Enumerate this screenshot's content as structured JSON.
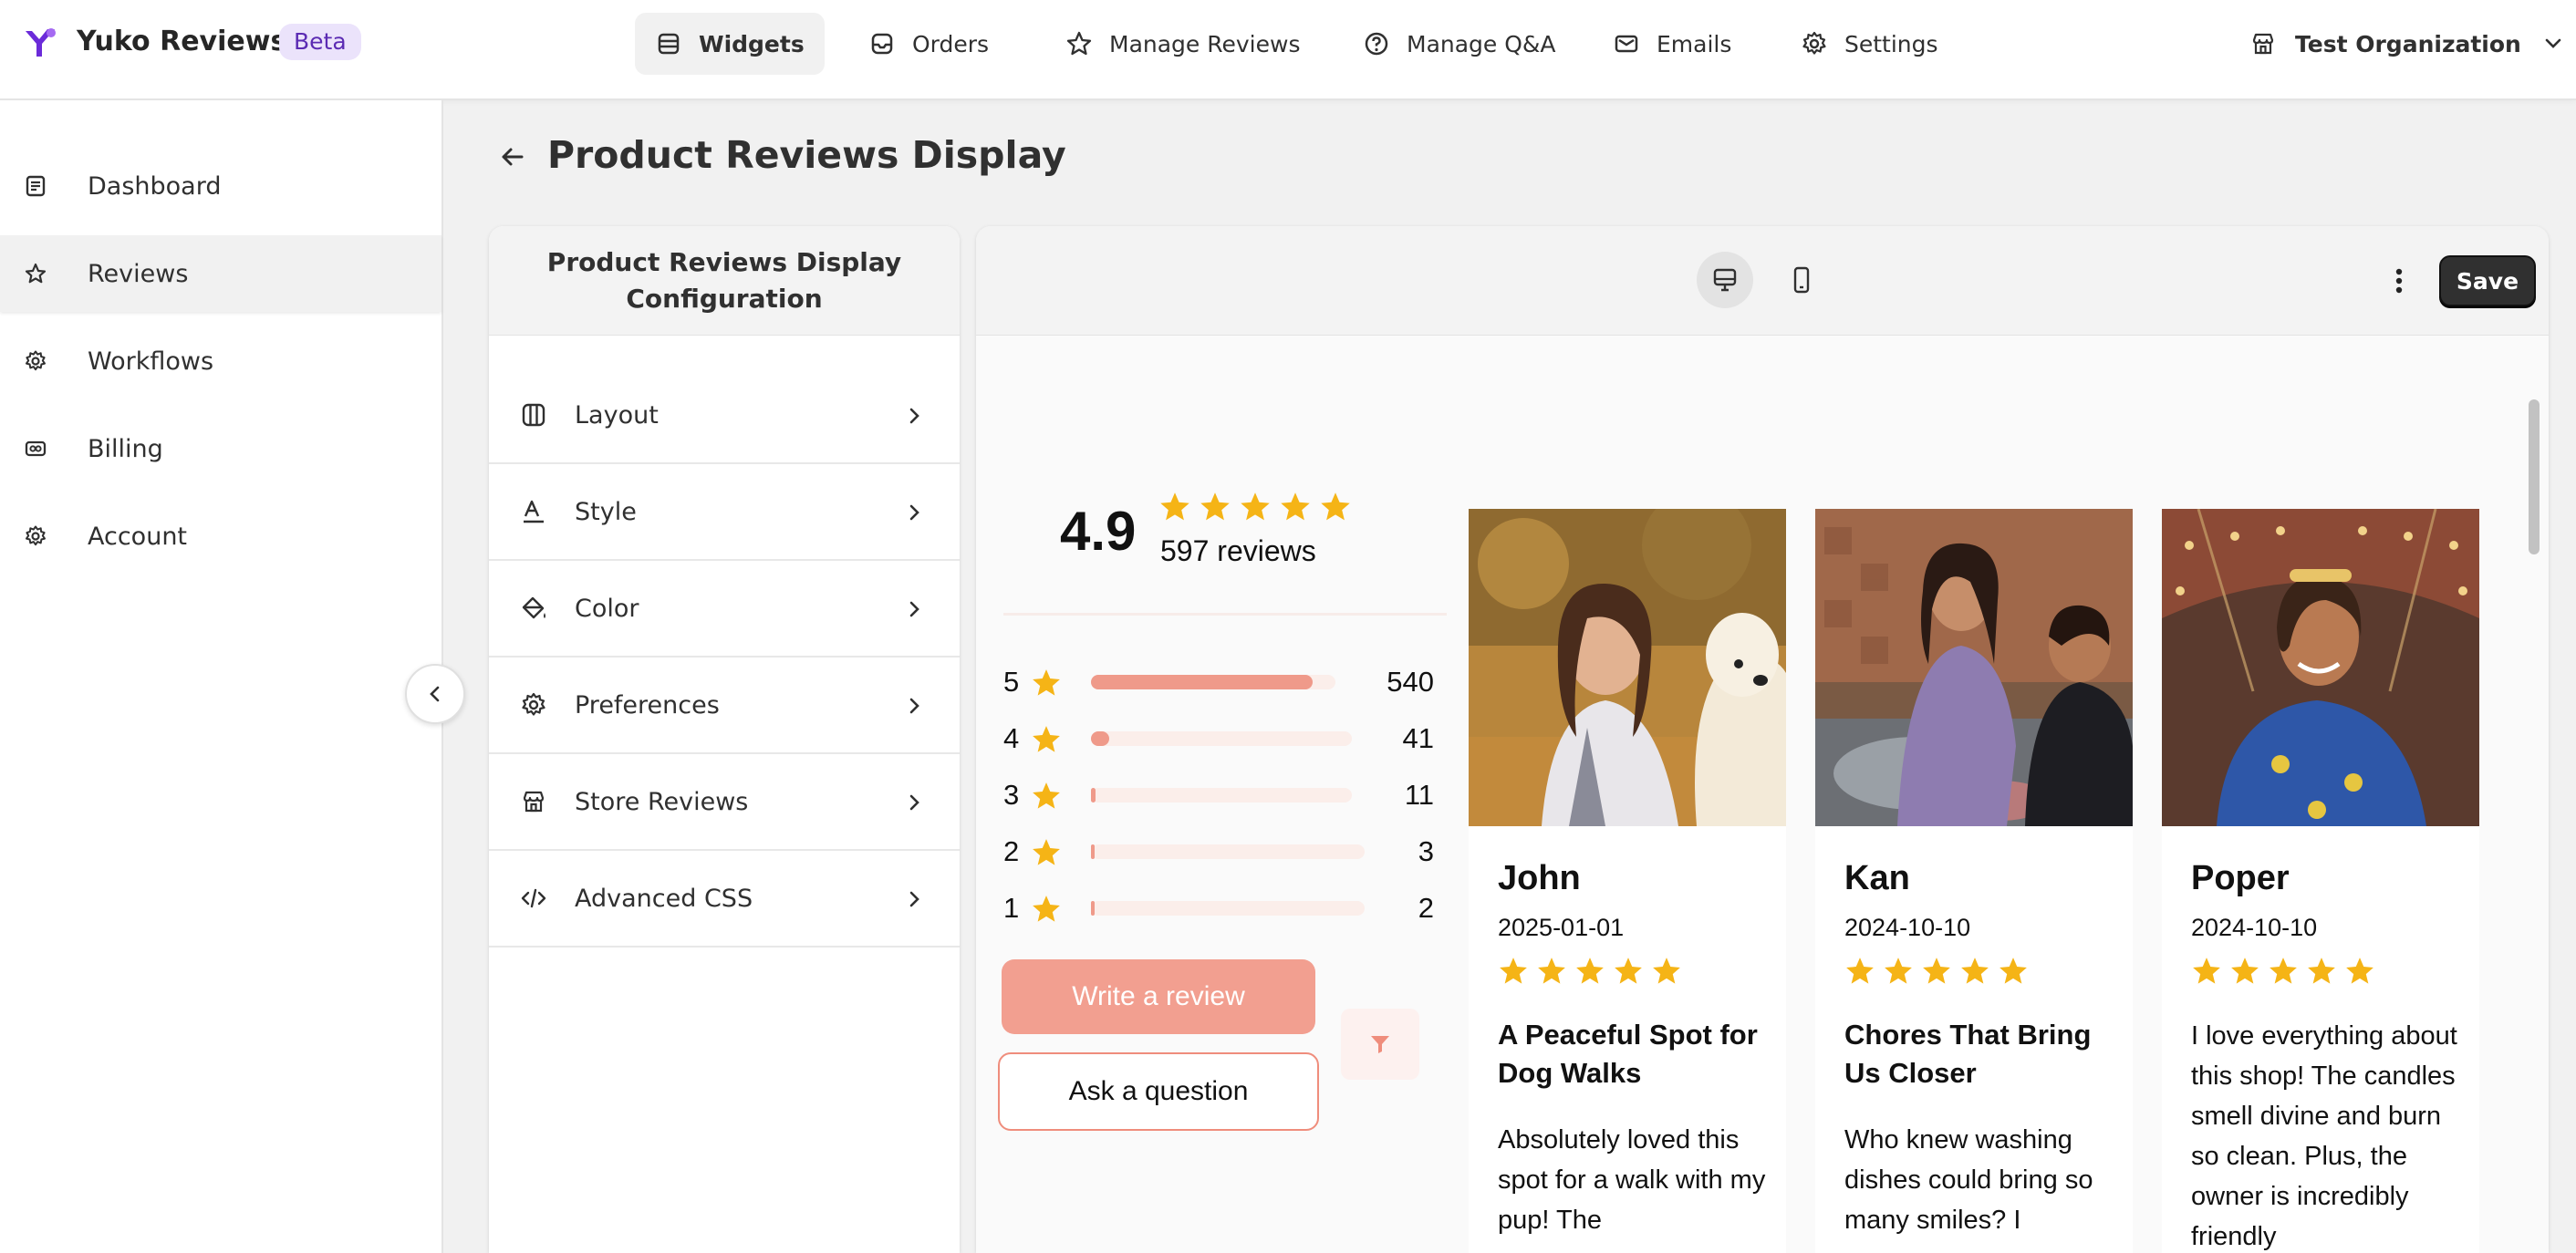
{
  "app": {
    "name": "Yuko Reviews",
    "badge": "Beta",
    "brand_color": "#6b2bd9"
  },
  "topnav": {
    "items": [
      {
        "label": "Widgets",
        "icon": "widgets-icon",
        "active": true
      },
      {
        "label": "Orders",
        "icon": "inbox-icon"
      },
      {
        "label": "Manage Reviews",
        "icon": "star-icon"
      },
      {
        "label": "Manage Q&A",
        "icon": "question-circle-icon"
      },
      {
        "label": "Emails",
        "icon": "mail-icon"
      },
      {
        "label": "Settings",
        "icon": "gear-icon"
      }
    ],
    "organization": "Test Organization"
  },
  "sidebar": {
    "items": [
      {
        "label": "Dashboard",
        "icon": "dashboard-icon"
      },
      {
        "label": "Reviews",
        "icon": "star-icon",
        "active": true
      },
      {
        "label": "Workflows",
        "icon": "workflow-gear-icon"
      },
      {
        "label": "Billing",
        "icon": "billing-icon"
      },
      {
        "label": "Account",
        "icon": "gear-icon"
      }
    ]
  },
  "page": {
    "title": "Product Reviews Display"
  },
  "config": {
    "title": "Product Reviews Display Configuration",
    "items": [
      {
        "label": "Layout",
        "icon": "layout-icon"
      },
      {
        "label": "Style",
        "icon": "text-style-icon"
      },
      {
        "label": "Color",
        "icon": "paint-bucket-icon"
      },
      {
        "label": "Preferences",
        "icon": "gear-icon"
      },
      {
        "label": "Store Reviews",
        "icon": "store-icon"
      },
      {
        "label": "Advanced CSS",
        "icon": "code-icon"
      }
    ]
  },
  "preview": {
    "save_label": "Save",
    "view_mode": "desktop",
    "accent_color": "#ef8d7c",
    "star_color": "#f5b416",
    "summary": {
      "average": "4.9",
      "average_stars": 5,
      "total_label": "597 reviews",
      "breakdown": [
        {
          "stars": "5",
          "count": "540",
          "fraction": 0.905
        },
        {
          "stars": "4",
          "count": "41",
          "fraction": 0.069
        },
        {
          "stars": "3",
          "count": "11",
          "fraction": 0.018
        },
        {
          "stars": "2",
          "count": "3",
          "fraction": 0.005
        },
        {
          "stars": "1",
          "count": "2",
          "fraction": 0.003
        }
      ]
    },
    "write_label": "Write a review",
    "ask_label": "Ask a question",
    "reviews": [
      {
        "name": "John",
        "date": "2025-01-01",
        "rating": 5,
        "title": "A Peaceful Spot for Dog Walks",
        "body": "Absolutely loved this spot for a walk with my pup! The"
      },
      {
        "name": "Kan",
        "date": "2024-10-10",
        "rating": 5,
        "title": "Chores That Bring Us Closer",
        "body": "Who knew washing dishes could bring so many smiles? I"
      },
      {
        "name": "Poper",
        "date": "2024-10-10",
        "rating": 5,
        "title": "",
        "body": "I love everything about this shop! The candles smell divine and burn so clean. Plus, the owner is incredibly friendly"
      }
    ]
  }
}
